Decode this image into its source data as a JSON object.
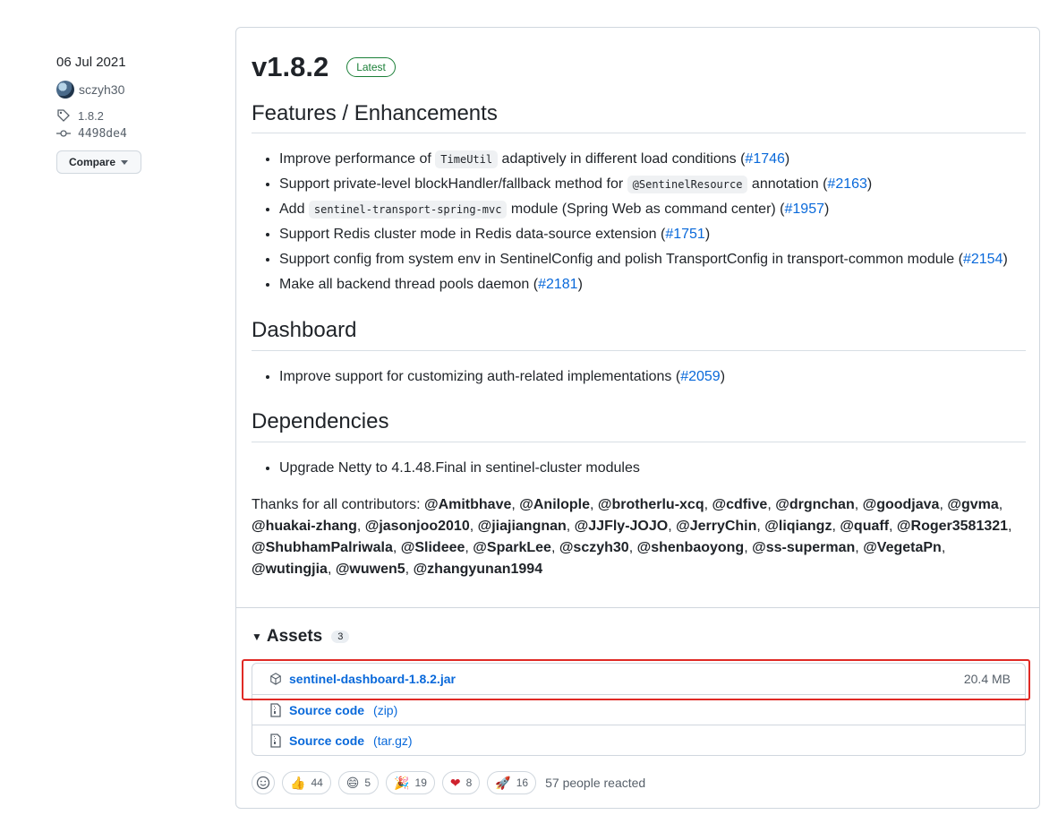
{
  "meta": {
    "date": "06 Jul 2021",
    "author": "sczyh30",
    "tag": "1.8.2",
    "commit": "4498de4",
    "compare_label": "Compare"
  },
  "release": {
    "title": "v1.8.2",
    "badge": "Latest"
  },
  "sections": {
    "features": {
      "heading": "Features / Enhancements",
      "items": [
        {
          "pre": "Improve performance of ",
          "code": "TimeUtil",
          "post": " adaptively in different load conditions (",
          "link": "#1746",
          "end": ")"
        },
        {
          "pre": "Support private-level blockHandler/fallback method for ",
          "code": "@SentinelResource",
          "post": " annotation (",
          "link": "#2163",
          "end": ")"
        },
        {
          "pre": "Add ",
          "code": "sentinel-transport-spring-mvc",
          "post": " module (Spring Web as command center) (",
          "link": "#1957",
          "end": ")"
        },
        {
          "pre": "Support Redis cluster mode in Redis data-source extension (",
          "link": "#1751",
          "end": ")"
        },
        {
          "pre": "Support config from system env in SentinelConfig and polish TransportConfig in transport-common module (",
          "link": "#2154",
          "end": ")"
        },
        {
          "pre": "Make all backend thread pools daemon (",
          "link": "#2181",
          "end": ")"
        }
      ]
    },
    "dashboard": {
      "heading": "Dashboard",
      "items": [
        {
          "pre": "Improve support for customizing auth-related implementations (",
          "link": "#2059",
          "end": ")"
        }
      ]
    },
    "dependencies": {
      "heading": "Dependencies",
      "items": [
        {
          "pre": "Upgrade Netty to 4.1.48.Final in sentinel-cluster modules"
        }
      ]
    }
  },
  "thanks": {
    "prefix": "Thanks for all contributors: ",
    "contributors": [
      "@Amitbhave",
      "@Anilople",
      "@brotherlu-xcq",
      "@cdfive",
      "@drgnchan",
      "@goodjava",
      "@gvma",
      "@huakai-zhang",
      "@jasonjoo2010",
      "@jiajiangnan",
      "@JJFly-JOJO",
      "@JerryChin",
      "@liqiangz",
      "@quaff",
      "@Roger3581321",
      "@ShubhamPalriwala",
      "@Slideee",
      "@SparkLee",
      "@sczyh30",
      "@shenbaoyong",
      "@ss-superman",
      "@VegetaPn",
      "@wutingjia",
      "@wuwen5",
      "@zhangyunan1994"
    ]
  },
  "assets": {
    "heading": "Assets",
    "count": "3",
    "items": [
      {
        "name": "sentinel-dashboard-1.8.2.jar",
        "size": "20.4 MB",
        "icon": "package-icon"
      },
      {
        "name": "Source code",
        "format": "(zip)",
        "icon": "file-zip-icon"
      },
      {
        "name": "Source code",
        "format": "(tar.gz)",
        "icon": "file-zip-icon"
      }
    ]
  },
  "reactions": {
    "items": [
      {
        "emoji": "👍",
        "count": "44",
        "icon": "thumbs-up-icon"
      },
      {
        "emoji": "😄",
        "count": "5",
        "icon": "laugh-icon"
      },
      {
        "emoji": "🎉",
        "count": "19",
        "icon": "hooray-icon"
      },
      {
        "emoji": "❤",
        "count": "8",
        "icon": "heart-icon"
      },
      {
        "emoji": "🚀",
        "count": "16",
        "icon": "rocket-icon"
      }
    ],
    "summary": "57 people reacted"
  },
  "colors": {
    "link": "#0969da",
    "latest_badge": "#1a7f37",
    "highlight": "#e02a25"
  }
}
